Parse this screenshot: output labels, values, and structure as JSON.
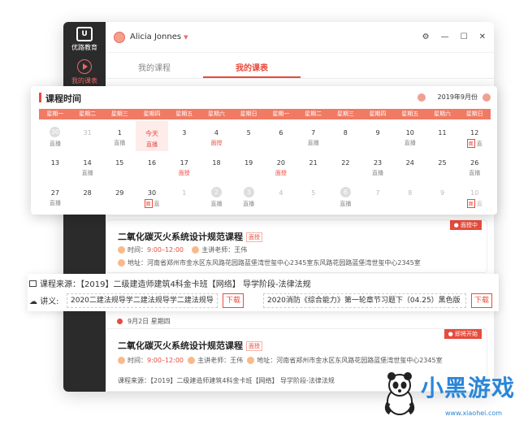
{
  "app": {
    "logo_text": "优路教育",
    "nav_item": "我的课表",
    "user_name": "Alicia Jonnes",
    "tabs": [
      "我的课程",
      "我的课表"
    ],
    "accent": "#e74c3c"
  },
  "calendar": {
    "title": "课程时间",
    "month": "2019年9月份",
    "weekdays": [
      "星期一",
      "星期二",
      "星期三",
      "星期四",
      "星期五",
      "星期六",
      "星期日",
      "星期一",
      "星期二",
      "星期三",
      "星期四",
      "星期五",
      "星期六",
      "星期日"
    ],
    "rows": [
      [
        {
          "d": "30",
          "s": "直播",
          "t": "circ"
        },
        {
          "d": "31",
          "t": "dim"
        },
        {
          "d": "1",
          "s": "直播"
        },
        {
          "d": "今天",
          "s": "直播",
          "t": "today"
        },
        {
          "d": "3"
        },
        {
          "d": "4",
          "s": "面授",
          "sr": true
        },
        {
          "d": "5"
        },
        {
          "d": "6"
        },
        {
          "d": "7",
          "s": "直播"
        },
        {
          "d": "8"
        },
        {
          "d": "9"
        },
        {
          "d": "10",
          "s": "直播"
        },
        {
          "d": "11"
        },
        {
          "d": "12",
          "s": "直",
          "m": "面"
        }
      ],
      [
        {
          "d": "13"
        },
        {
          "d": "14",
          "s": "直播"
        },
        {
          "d": "15"
        },
        {
          "d": "16"
        },
        {
          "d": "17",
          "s": "面授",
          "sr": true
        },
        {
          "d": "18"
        },
        {
          "d": "19"
        },
        {
          "d": "20",
          "s": "面授",
          "sr": true
        },
        {
          "d": "21"
        },
        {
          "d": "22"
        },
        {
          "d": "23",
          "s": "直播"
        },
        {
          "d": "24"
        },
        {
          "d": "25"
        },
        {
          "d": "26",
          "s": "直播"
        }
      ],
      [
        {
          "d": "27",
          "s": "直播"
        },
        {
          "d": "28"
        },
        {
          "d": "29"
        },
        {
          "d": "30",
          "s": "直",
          "m": "面"
        },
        {
          "d": "1",
          "t": "dim"
        },
        {
          "d": "2",
          "s": "直播",
          "t": "circ"
        },
        {
          "d": "3",
          "s": "直播",
          "t": "circ"
        },
        {
          "d": "4",
          "t": "dim"
        },
        {
          "d": "5",
          "t": "dim"
        },
        {
          "d": "6",
          "s": "直播",
          "t": "circ"
        },
        {
          "d": "7",
          "t": "dim"
        },
        {
          "d": "8",
          "t": "dim"
        },
        {
          "d": "9",
          "t": "dim"
        },
        {
          "d": "10",
          "s": "直",
          "m": "面",
          "t": "dim"
        }
      ]
    ]
  },
  "course1": {
    "title": "二氧化碳灭火系统设计规范课程",
    "tag": "面授",
    "status": "面授中",
    "time_label": "时间：",
    "time": "9:00–12:00",
    "teacher_label": "主讲老师：",
    "teacher": "王伟",
    "addr_label": "地址：",
    "addr": "河南省郑州市金水区东风路花园路蓝堡湾世玺中心2345室东风路花园路蓝堡湾世玺中心2345室"
  },
  "source": {
    "label": "课程来源：",
    "value": "【2019】二级建造师建筑4科金卡班【网络】  导学阶段-法律法规",
    "handout_label": "讲义:",
    "handout1": "2020二建法规导学二建法规导学二建法规导",
    "handout2": "2020消防《综合能力》第一轮章节习题下（04.25）黑色版",
    "download": "下载"
  },
  "date2": "9月2日  星期四",
  "course2": {
    "title": "二氧化碳灭火系统设计规范课程",
    "tag": "面授",
    "status": "即将开始",
    "time_label": "时间：",
    "time": "9:00–12:00",
    "teacher_label": "主讲老师：",
    "teacher": "王伟",
    "addr_label": "地址：",
    "addr": "河南省郑州市金水区东风路花园路蓝堡湾世玺中心2345室",
    "source": "课程来源：【2019】二级建造师建筑4科金卡班【网络】  导学阶段-法律法规"
  },
  "watermark": {
    "text": "小黑游戏",
    "url": "www.xiaohei.com"
  }
}
